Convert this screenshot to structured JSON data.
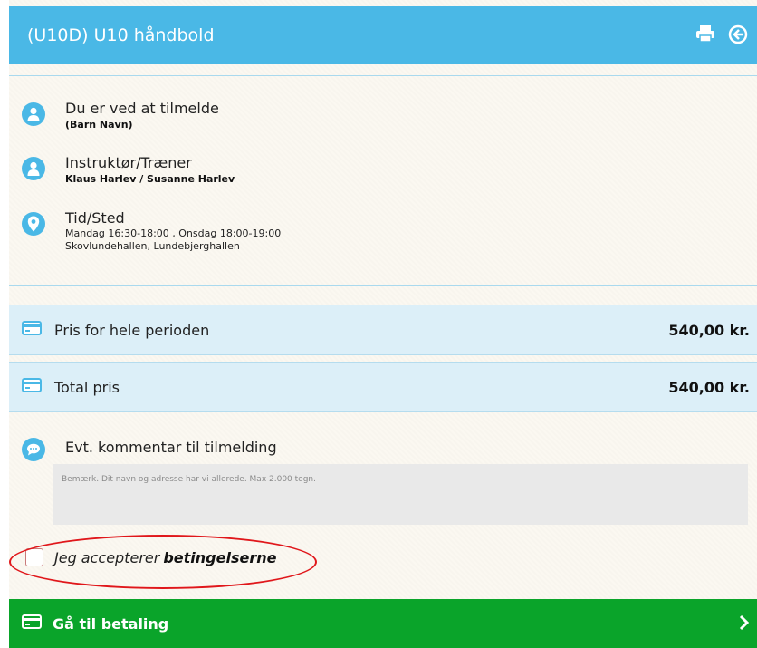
{
  "header": {
    "title": "(U10D) U10 håndbold",
    "icons": [
      "print-icon",
      "back-circle-icon"
    ]
  },
  "info": {
    "registrant": {
      "label": "Du er ved at tilmelde",
      "value": "(Barn Navn)"
    },
    "instructor": {
      "label": "Instruktør/Træner",
      "value": "Klaus Harlev / Susanne Harlev"
    },
    "time_place": {
      "label": "Tid/Sted",
      "time": "Mandag 16:30-18:00 , Onsdag 18:00-19:00",
      "place": "Skovlundehallen, Lundebjerghallen"
    }
  },
  "prices": [
    {
      "label": "Pris for hele perioden",
      "value": "540,00 kr."
    },
    {
      "label": "Total pris",
      "value": "540,00 kr."
    }
  ],
  "comment": {
    "label": "Evt. kommentar til tilmelding",
    "placeholder": "Bemærk. Dit navn og adresse har vi allerede. Max 2.000 tegn.",
    "value": ""
  },
  "terms": {
    "text": "Jeg accepterer",
    "link": "betingelserne",
    "checked": false
  },
  "pay_button": {
    "label": "Gå til betaling"
  },
  "colors": {
    "header": "#4ab8e6",
    "price_row": "#dceff8",
    "pay_button": "#0aa42a",
    "annotation": "#e0171b"
  }
}
